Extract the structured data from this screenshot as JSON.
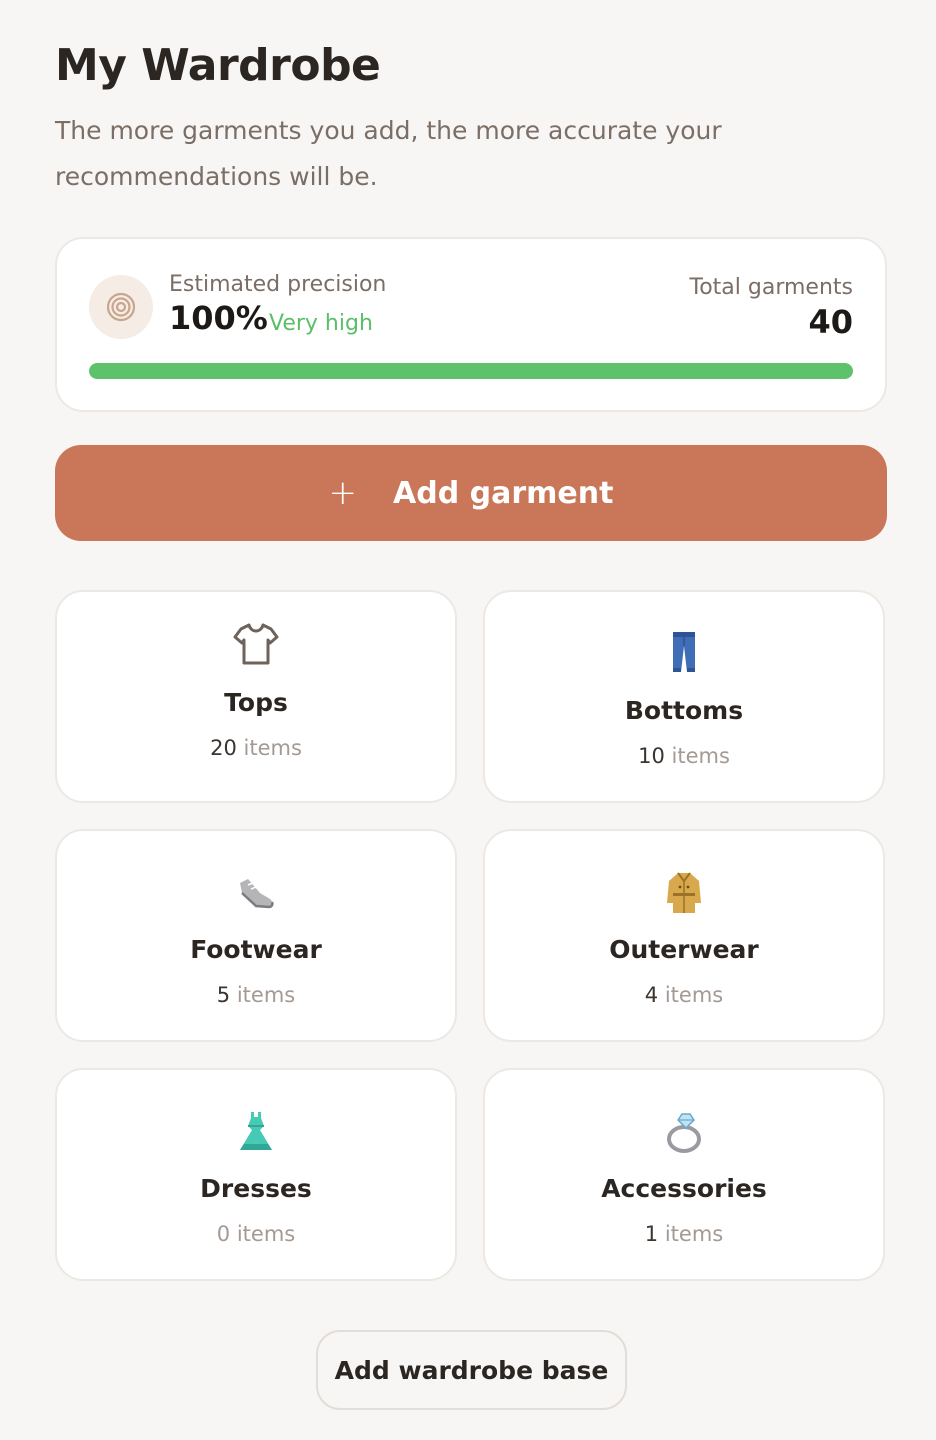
{
  "header": {
    "title": "My Wardrobe",
    "subtitle": "The more garments you add, the more accurate your recommendations will be."
  },
  "precision": {
    "label": "Estimated precision",
    "value": "100%",
    "level": "Very high",
    "progress_percent": 100,
    "total_label": "Total garments",
    "total_value": "40",
    "icon": "target-icon",
    "colors": {
      "progress": "#5ec26a",
      "level_text": "#5bbf6a"
    }
  },
  "actions": {
    "add_garment_label": "Add garment",
    "add_garment_icon": "plus-icon",
    "add_base_label": "Add wardrobe base",
    "accent_color": "#c97758"
  },
  "categories": [
    {
      "name": "Tops",
      "count": "20",
      "unit": "items",
      "icon": "t-shirt-icon"
    },
    {
      "name": "Bottoms",
      "count": "10",
      "unit": "items",
      "icon": "jeans-icon"
    },
    {
      "name": "Footwear",
      "count": "5",
      "unit": "items",
      "icon": "sneaker-icon"
    },
    {
      "name": "Outerwear",
      "count": "4",
      "unit": "items",
      "icon": "coat-icon"
    },
    {
      "name": "Dresses",
      "count": "0",
      "unit": "items",
      "icon": "dress-icon"
    },
    {
      "name": "Accessories",
      "count": "1",
      "unit": "items",
      "icon": "ring-icon"
    }
  ]
}
